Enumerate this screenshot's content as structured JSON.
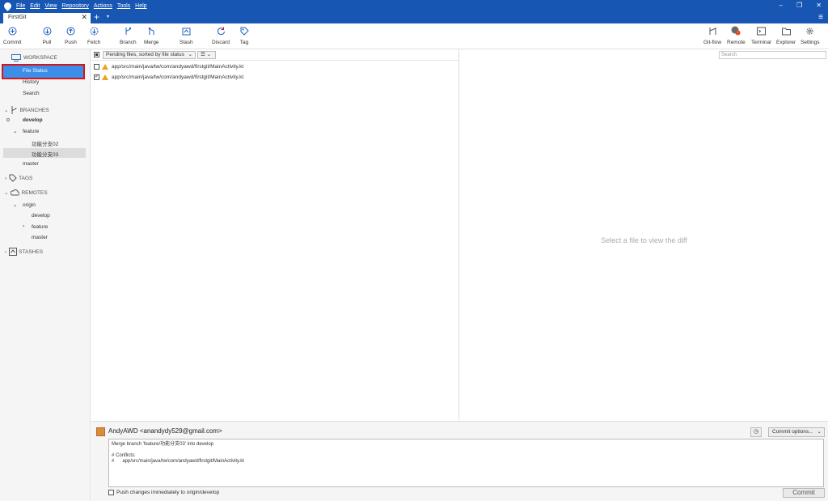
{
  "menu": [
    "File",
    "Edit",
    "View",
    "Repository",
    "Actions",
    "Tools",
    "Help"
  ],
  "window_controls": {
    "minimize": "–",
    "restore": "❐",
    "close": "✕"
  },
  "tab": {
    "title": "FirstGit",
    "close": "✕",
    "add": "+",
    "menu": "▾"
  },
  "toolbar": {
    "commit": "Commit",
    "pull": "Pull",
    "push": "Push",
    "fetch": "Fetch",
    "branch": "Branch",
    "merge": "Merge",
    "stash": "Stash",
    "discard": "Discard",
    "tag": "Tag",
    "gitflow": "Git-flow",
    "remote": "Remote",
    "terminal": "Terminal",
    "explorer": "Explorer",
    "settings": "Settings"
  },
  "search": {
    "placeholder": "Search"
  },
  "sidebar": {
    "workspace": "WORKSPACE",
    "file_status": "File Status",
    "history": "History",
    "search": "Search",
    "branches": "BRANCHES",
    "develop": "develop",
    "feature": "feature",
    "feature_02": "功能分支02",
    "feature_03": "功能分支03",
    "master": "master",
    "tags": "TAGS",
    "remotes": "REMOTES",
    "origin": "origin",
    "origin_develop": "develop",
    "origin_feature": "feature",
    "origin_master": "master",
    "stashes": "STASHES"
  },
  "filelist": {
    "sort_label": "Pending files, sorted by file status",
    "view_toggle": "☰ ⌄",
    "files": [
      {
        "path": "app/src/main/java/tw/com/andyawd/firstgit/MainActivity.kt",
        "checked": false
      },
      {
        "path": "app/src/main/java/tw/com/andyawd/firstgit/MainActivity.kt",
        "checked": true
      }
    ]
  },
  "diff": {
    "empty_message": "Select a file to view the diff"
  },
  "commit": {
    "author": "AndyAWD <anandydy529@gmail.com>",
    "message": "Merge branch 'feature/功能分支03' into develop\n\n# Conflicts:\n#\tapp/src/main/java/tw/com/andyawd/firstgit/MainActivity.kt",
    "options": "Commit options...",
    "push_label": "Push changes immediately to origin/develop",
    "button": "Commit"
  }
}
